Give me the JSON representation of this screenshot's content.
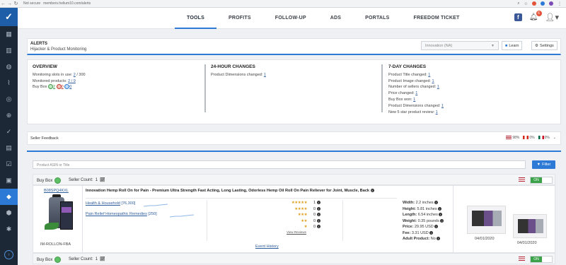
{
  "browser": {
    "security": "Not secure",
    "url": "members.helium10.com/alerts",
    "back": "←",
    "forward": "→",
    "reload": "↻"
  },
  "nav": {
    "tabs": [
      "TOOLS",
      "PROFITS",
      "FOLLOW-UP",
      "ADS",
      "PORTALS",
      "FREEDOM TICKET"
    ],
    "active_tab": "TOOLS",
    "notification_count": "6",
    "facebook_glyph": "f"
  },
  "alerts_header": {
    "title": "ALERTS",
    "subtitle": "Hijacker & Product Monitoring",
    "account_select": "Innovation (NA)",
    "learn_label": "Learn",
    "settings_label": "Settings"
  },
  "overview": {
    "heading": "OVERVIEW",
    "slots_label": "Monitoring slots in use:",
    "slots_used": "2",
    "slots_total": "/ 300",
    "monitored_label": "Monitored products:",
    "monitored_value": "2 / 9",
    "buybox_label": "Buy Box",
    "buybox_green": "2",
    "buybox_red": "0",
    "buybox_blue": "0"
  },
  "changes_24h": {
    "heading": "24-HOUR CHANGES",
    "items": [
      {
        "label": "Product Dimensions changed:",
        "value": "1"
      }
    ]
  },
  "changes_7d": {
    "heading": "7-DAY CHANGES",
    "items": [
      {
        "label": "Product Title changed:",
        "value": "1"
      },
      {
        "label": "Product Image changed:",
        "value": "1"
      },
      {
        "label": "Number of sellers changed:",
        "value": "1"
      },
      {
        "label": "Price changed:",
        "value": "1"
      },
      {
        "label": "Buy Box won:",
        "value": "1"
      },
      {
        "label": "Product Dimensions changed:",
        "value": "1"
      },
      {
        "label": "New 5 star product review:",
        "value": "1"
      }
    ]
  },
  "seller_feedback": {
    "title": "Seller Feedback",
    "us": "98%",
    "ca": "0%",
    "mx": "0%"
  },
  "search": {
    "placeholder": "Product ASIN or Title",
    "filter_label": "Filter"
  },
  "product": {
    "buybox_label": "Buy Box",
    "seller_count_label": "Seller Count:",
    "seller_count": "1",
    "toggle": "ON",
    "asin": "B08SPQ4KXL",
    "fulfillment": "IM-ROLLON-FBA",
    "title": "Innovation Hemp Roll On for Pain - Premium Ultra Strength Fast Acting, Long Lasting, Odorless Hemp Oil Roll On Pain Reliever for Joint, Muscle, Back",
    "categories": [
      {
        "name": "Health & Household",
        "rank": "[76,300]"
      },
      {
        "name": "Pain Relief Homeopathic Remedies",
        "rank": "[250]"
      }
    ],
    "ratings": [
      {
        "stars": "★★★★★",
        "count": "1"
      },
      {
        "stars": "★★★★",
        "count": "0"
      },
      {
        "stars": "★★★",
        "count": "0"
      },
      {
        "stars": "★★",
        "count": "0"
      },
      {
        "stars": "★",
        "count": "0"
      }
    ],
    "view_reviews": "View Reviews",
    "specs": [
      {
        "label": "Width:",
        "value": "2.2 inches"
      },
      {
        "label": "Height:",
        "value": "5.81 inches"
      },
      {
        "label": "Length:",
        "value": "6.54 inches"
      },
      {
        "label": "Weight:",
        "value": "0.35 pounds"
      },
      {
        "label": "Price:",
        "value": "29.95 USD"
      },
      {
        "label": "Fee:",
        "value": "3.31 USD"
      },
      {
        "label": "Adult Product:",
        "value": "No"
      }
    ],
    "event_history": "Event History",
    "image_dates": [
      "04/01/2020",
      "04/01/2020"
    ]
  },
  "product2": {
    "buybox_label": "Buy Box",
    "seller_count_label": "Seller Count:",
    "seller_count": "1",
    "toggle": "ON"
  },
  "colors": {
    "accent": "#2d7ad6",
    "sidebar": "#1d2836",
    "toggle_on": "#3ca24a"
  }
}
